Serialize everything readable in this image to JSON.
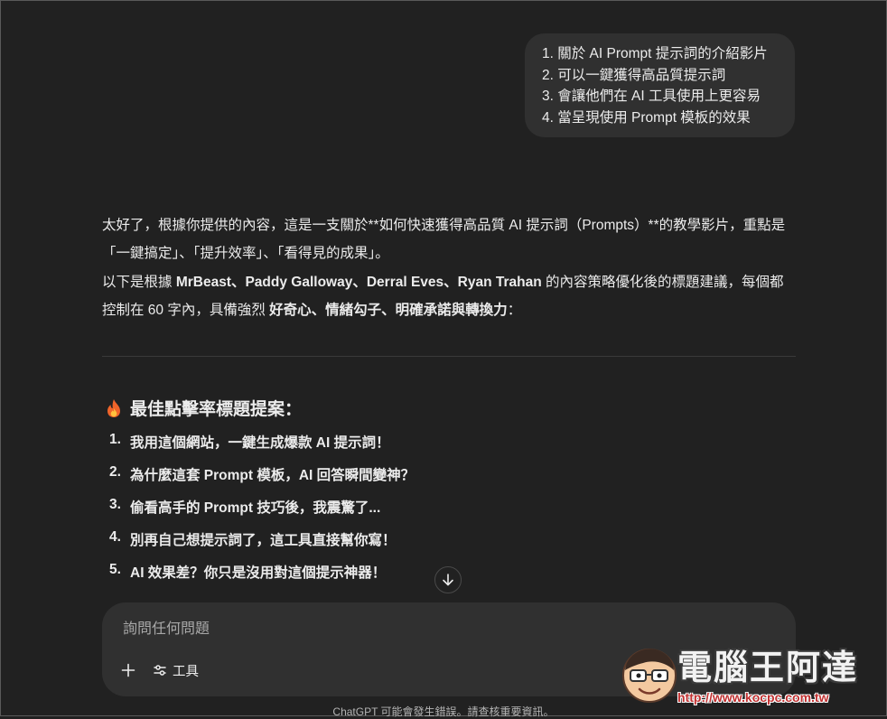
{
  "user_message": {
    "lines": [
      "1. 關於 AI Prompt 提示詞的介紹影片",
      "2. 可以一鍵獲得高品質提示詞",
      "3. 會讓他們在 AI 工具使用上更容易",
      "4. 當呈現使用 Prompt 模板的效果"
    ]
  },
  "assistant": {
    "para1": "太好了，根據你提供的內容，這是一支關於**如何快速獲得高品質 AI 提示詞（Prompts）**的教學影片，重點是「一鍵搞定」、「提升效率」、「看得見的成果」。",
    "para2_prefix": "以下是根據 ",
    "para2_names": "MrBeast、Paddy Galloway、Derral Eves、Ryan Trahan",
    "para2_middle": " 的內容策略優化後的標題建議，每個都控制在 60 字內，具備強烈 ",
    "para2_traits": "好奇心、情緒勾子、明確承諾與轉換力",
    "para2_suffix": "：",
    "section_title": "最佳點擊率標題提案：",
    "section_icon": "fire-icon",
    "titles": [
      {
        "num": "1.",
        "text": "我用這個網站，一鍵生成爆款 AI 提示詞！"
      },
      {
        "num": "2.",
        "text": "為什麼這套 Prompt 模板，AI 回答瞬間變神？"
      },
      {
        "num": "3.",
        "text": "偷看高手的 Prompt 技巧後，我震驚了..."
      },
      {
        "num": "4.",
        "text": "別再自己想提示詞了，這工具直接幫你寫！"
      },
      {
        "num": "5.",
        "text": "AI 效果差？你只是沒用對這個提示神器！"
      }
    ]
  },
  "composer": {
    "placeholder": "詢問任何問題",
    "tools_label": "工具"
  },
  "disclaimer": "ChatGPT 可能會發生錯誤。請查核重要資訊。",
  "watermark": {
    "title": "電腦王阿達",
    "url": "http://www.kocpc.com.tw"
  },
  "colors": {
    "background": "#212121",
    "bubble": "#303030",
    "composer": "#303030",
    "text": "#ececec"
  }
}
